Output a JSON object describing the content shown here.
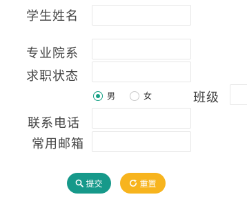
{
  "form": {
    "name_label": "学生姓名",
    "major_label": "专业院系",
    "job_status_label": "求职状态",
    "gender": {
      "options": [
        "男",
        "女"
      ],
      "selected": "男"
    },
    "class_label": "班级",
    "phone_label": "联系电话",
    "email_label": "常用邮箱"
  },
  "buttons": {
    "submit_label": "提交",
    "reset_label": "重置"
  },
  "colors": {
    "primary": "#16998a",
    "warning": "#f7b41e"
  },
  "icons": {
    "submit": "search-icon",
    "reset": "refresh-icon"
  }
}
